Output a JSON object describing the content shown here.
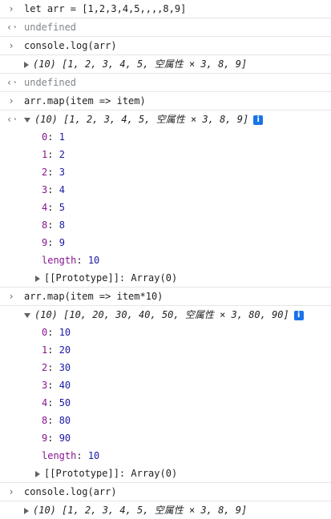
{
  "entries": [
    {
      "prompt": ">",
      "code": "let arr = [1,2,3,4,5,,,,8,9]"
    },
    {
      "result": "undefined"
    },
    {
      "prompt": ">",
      "code": "console.log(arr)"
    },
    {
      "log": "(10) [1, 2, 3, 4, 5, 空属性 × 3, 8, 9]"
    },
    {
      "result": "undefined"
    },
    {
      "prompt": ">",
      "code": "arr.map(item => item)"
    },
    {
      "summary": "(10) [1, 2, 3, 4, 5, 空属性 × 3, 8, 9]",
      "items": [
        {
          "key": "0",
          "value": "1"
        },
        {
          "key": "1",
          "value": "2"
        },
        {
          "key": "2",
          "value": "3"
        },
        {
          "key": "3",
          "value": "4"
        },
        {
          "key": "4",
          "value": "5"
        },
        {
          "key": "8",
          "value": "8"
        },
        {
          "key": "9",
          "value": "9"
        }
      ],
      "length_key": "length",
      "length_value": "10",
      "prototype": "[[Prototype]]: Array(0)"
    },
    {
      "prompt": ">",
      "code": "arr.map(item => item*10)"
    },
    {
      "summary": "(10) [10, 20, 30, 40, 50, 空属性 × 3, 80, 90]",
      "items": [
        {
          "key": "0",
          "value": "10"
        },
        {
          "key": "1",
          "value": "20"
        },
        {
          "key": "2",
          "value": "30"
        },
        {
          "key": "3",
          "value": "40"
        },
        {
          "key": "4",
          "value": "50"
        },
        {
          "key": "8",
          "value": "80"
        },
        {
          "key": "9",
          "value": "90"
        }
      ],
      "length_key": "length",
      "length_value": "10",
      "prototype": "[[Prototype]]: Array(0)"
    },
    {
      "prompt": ">",
      "code": "console.log(arr)"
    },
    {
      "log": "(10) [1, 2, 3, 4, 5, 空属性 × 3, 8, 9]"
    }
  ],
  "icons": {
    "prompt": "chevron-right-icon",
    "result": "return-arrow-icon",
    "info": "info-icon"
  },
  "colors": {
    "key": "#881391",
    "number": "#1a1aa6",
    "muted": "#80868b",
    "info": "#1a73e8"
  }
}
